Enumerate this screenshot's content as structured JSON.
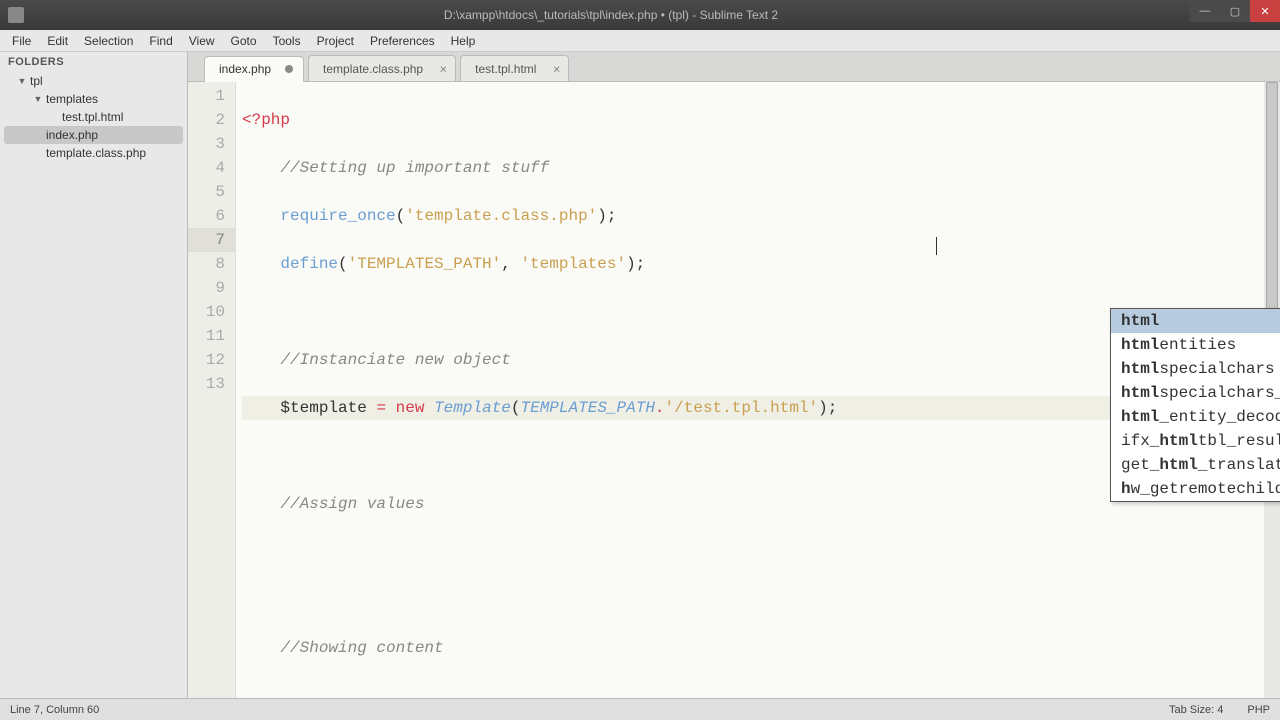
{
  "window": {
    "title": "D:\\xampp\\htdocs\\_tutorials\\tpl\\index.php • (tpl) - Sublime Text 2"
  },
  "menu": [
    "File",
    "Edit",
    "Selection",
    "Find",
    "View",
    "Goto",
    "Tools",
    "Project",
    "Preferences",
    "Help"
  ],
  "sidebar": {
    "header": "FOLDERS",
    "items": [
      {
        "label": "tpl",
        "indent": 1,
        "arrow": "▼"
      },
      {
        "label": "templates",
        "indent": 2,
        "arrow": "▼"
      },
      {
        "label": "test.tpl.html",
        "indent": 3,
        "arrow": ""
      },
      {
        "label": "index.php",
        "indent": 2,
        "arrow": "",
        "selected": true
      },
      {
        "label": "template.class.php",
        "indent": 2,
        "arrow": ""
      }
    ]
  },
  "tabs": [
    {
      "label": "index.php",
      "active": true,
      "dirty": true
    },
    {
      "label": "template.class.php",
      "active": false,
      "dirty": false
    },
    {
      "label": "test.tpl.html",
      "active": false,
      "dirty": false
    }
  ],
  "code": {
    "lines": [
      1,
      2,
      3,
      4,
      5,
      6,
      7,
      8,
      9,
      10,
      11,
      12,
      13
    ],
    "current_line": 7
  },
  "autocomplete": {
    "items": [
      {
        "text": "html",
        "match": "html",
        "hint": "html",
        "selected": true
      },
      {
        "text": "htmlentities",
        "match": "html",
        "rest": "entities"
      },
      {
        "text": "htmlspecialchars",
        "match": "html",
        "rest": "specialchars"
      },
      {
        "text": "htmlspecialchars_decode",
        "match": "html",
        "rest": "specialchars_decode"
      },
      {
        "text": "html_entity_decode",
        "match": "html",
        "rest": "_entity_decode"
      },
      {
        "text": "ifx_htmltbl_result",
        "pre": "ifx_",
        "match": "html",
        "rest": "tbl_result"
      },
      {
        "text": "get_html_translat…table",
        "pre": "get_",
        "match": "html",
        "rest": "_translat…table"
      },
      {
        "text": "hw_getremotechildren",
        "match": "h",
        "rest": "w_getremotechildren"
      }
    ]
  },
  "status": {
    "left": "Line 7, Column 60",
    "tab_size": "Tab Size: 4",
    "lang": "PHP"
  }
}
